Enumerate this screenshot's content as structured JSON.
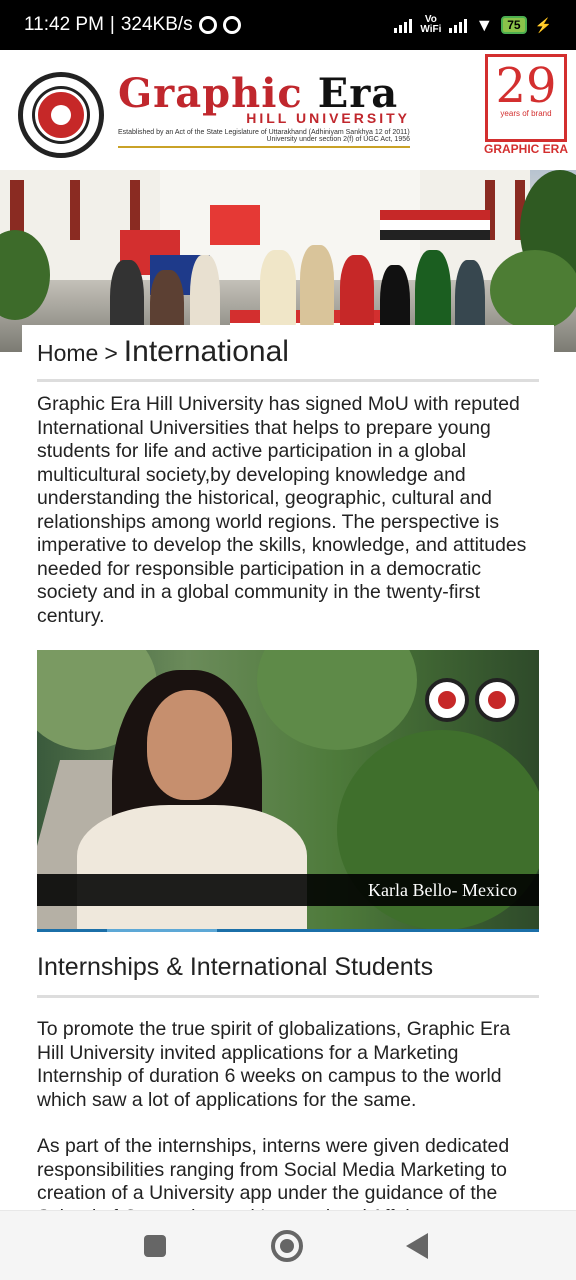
{
  "status_bar": {
    "time": "11:42 PM",
    "separator": "|",
    "speed": "324KB/s",
    "vowifi_top": "Vo",
    "vowifi_bottom": "WiFi",
    "battery": "75"
  },
  "header": {
    "brand_word1": "Graphic",
    "brand_word2": "Era",
    "brand_sub": "HILL UNIVERSITY",
    "established": "Established by an Act of the State Legislature of Uttarakhand (Adhiniyam Sankhya 12 of 2011)",
    "ugc": "University under section 2(f) of UGC Act, 1956",
    "badge_number": "29",
    "badge_years": "years of brand",
    "badge_caption": "GRAPHIC ERA"
  },
  "breadcrumb": {
    "home": "Home",
    "separator": ">",
    "current": "International"
  },
  "intro_text": "Graphic Era Hill University has signed MoU with reputed International Universities that helps to prepare young students for life and active participation in a global multicultural society,by developing knowledge and understanding the historical, geographic, cultural and relationships among world regions. The perspective is imperative to develop the skills, knowledge, and attitudes needed for responsible participation in a democratic society and in a global community in the twenty-first century.",
  "video": {
    "caption": "Karla Bello- Mexico"
  },
  "section": {
    "title": "Internships & International Students",
    "para1": "To promote the true spirit of globalizations, Graphic Era Hill University invited applications for a Marketing Internship of duration 6 weeks on campus to the world which saw a lot of applications for the same.",
    "para2": "As part of the internships, interns were given dedicated responsibilities ranging from Social Media Marketing to creation of a University app under the guidance of the School of Computing and International Affairs"
  }
}
